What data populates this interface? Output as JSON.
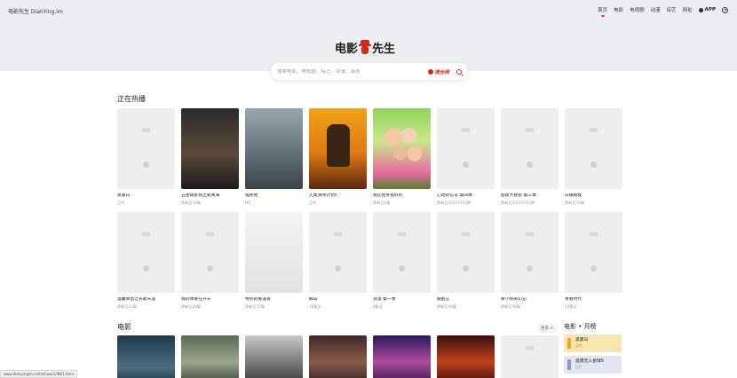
{
  "header": {
    "site_name": "电影先生 DianYing.im",
    "nav": [
      "首页",
      "电影",
      "电视剧",
      "动漫",
      "综艺",
      "网址"
    ],
    "app_label": "APP",
    "logo_left": "电影",
    "logo_right": "先生"
  },
  "search": {
    "placeholder": "搜索电影、电视剧、综艺、动漫、演员",
    "brand_label": "搜全网"
  },
  "now_playing": {
    "title": "正在热播",
    "row1": [
      {
        "title": "黑暴日",
        "sub": "正片"
      },
      {
        "title": "五星级卧底之寂寞海",
        "sub": "更新至16集"
      },
      {
        "title": "殖民地",
        "sub": "HD"
      },
      {
        "title": "人类清除计划5",
        "sub": "正片"
      },
      {
        "title": "我在他乡挺好的",
        "sub": "更新至6集"
      },
      {
        "title": "心动的信号 第四季",
        "sub": "更新至20210702期"
      },
      {
        "title": "超级大搜索 第三季",
        "sub": "更新至20210702期"
      },
      {
        "title": "乐播模板",
        "sub": "更新至16集"
      }
    ],
    "row2": [
      {
        "title": "温馨食谱之长歌天涯",
        "sub": "更新至23集"
      },
      {
        "title": "我的体重在升天",
        "sub": "更新至20集"
      },
      {
        "title": "特别的重逢夜",
        "sub": "更新至10集"
      },
      {
        "title": "鲸岛",
        "sub": "16集全"
      },
      {
        "title": "浪漫 第一季",
        "sub": "8集全"
      },
      {
        "title": "醒醒王",
        "sub": "更新至40集"
      },
      {
        "title": "萝小熊奇幻记",
        "sub": "更新至48集"
      },
      {
        "title": "青春时代",
        "sub": "18集全"
      }
    ]
  },
  "movies": {
    "title": "电影",
    "more_label": "更多 >"
  },
  "ranking": {
    "title": "电影 • 月榜",
    "items": [
      {
        "title": "黑暴日",
        "sub": "正片"
      },
      {
        "title": "遗落无人星球9",
        "sub": "正片"
      }
    ]
  },
  "status_bar": "www.dianyingim.com/show/1/98/1.html",
  "colors": {
    "accent": "#d9261c",
    "hero_bg": "#eceef2",
    "placeholder_bg": "#eeeeee"
  }
}
